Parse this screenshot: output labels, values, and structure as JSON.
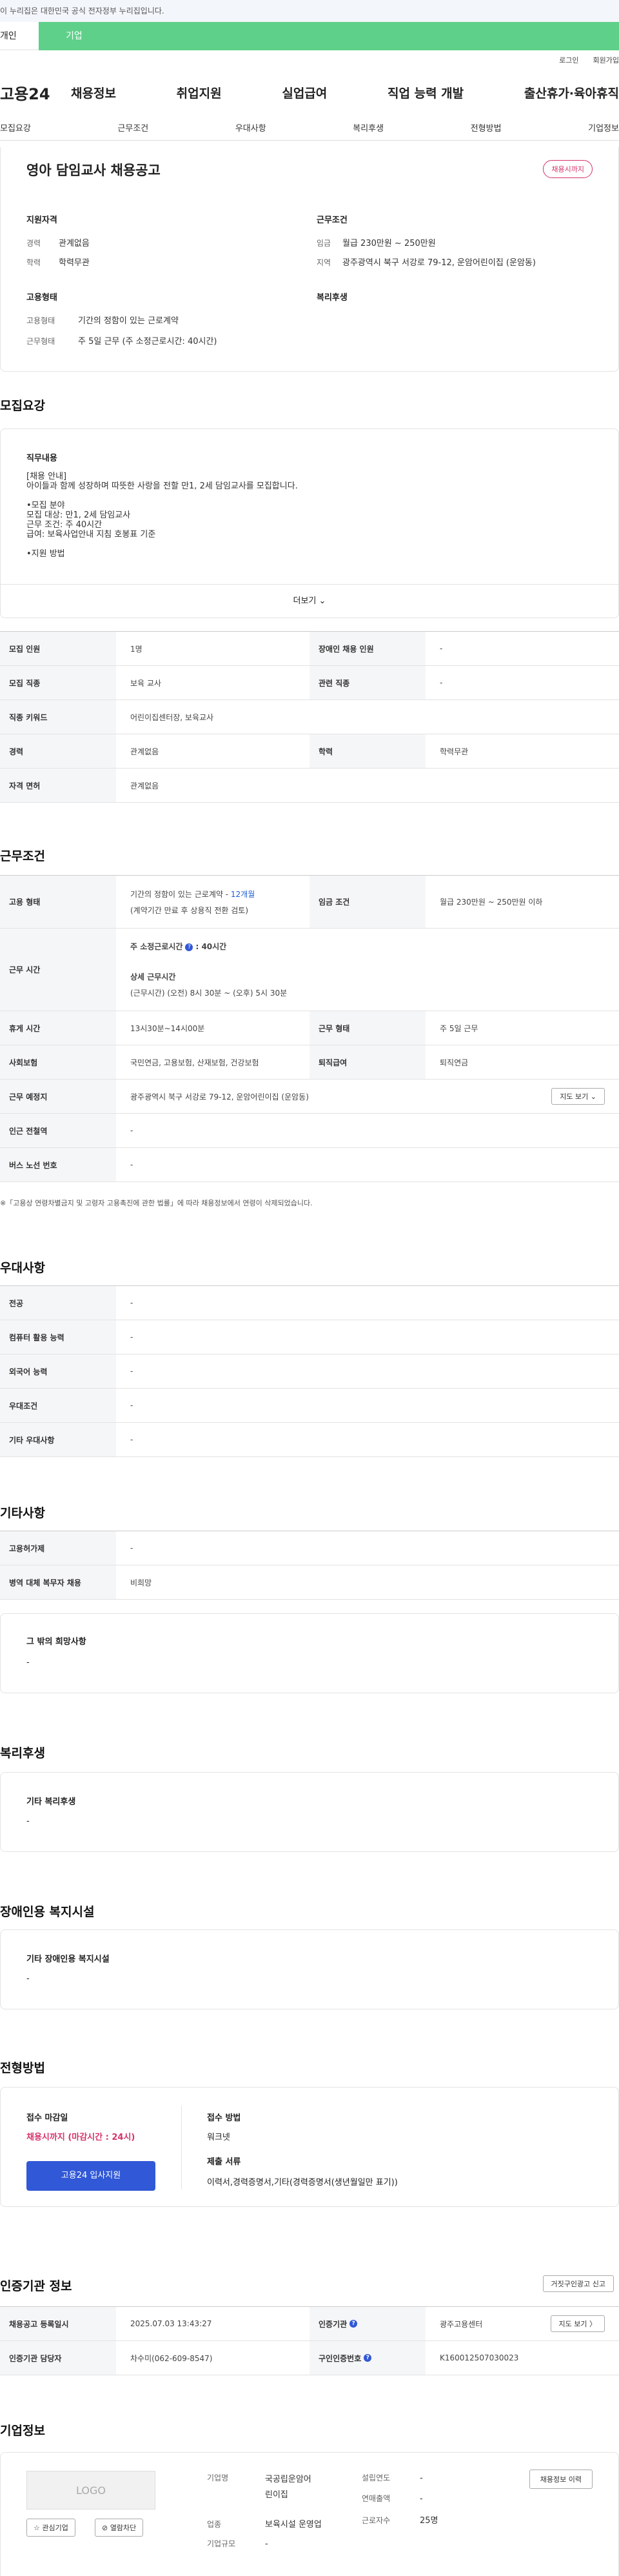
{
  "header": {
    "gov_notice": "이 누리집은 대한민국 공식 전자정부 누리집입니다.",
    "tab_person": "개인",
    "tab_company": "기업",
    "login": "로그인",
    "signup": "회원가입",
    "logo": "고용24"
  },
  "gnb": [
    "채용정보",
    "취업지원",
    "실업급여",
    "직업 능력 개발",
    "출산휴가·육아휴직"
  ],
  "subnav": [
    "모집요강",
    "근무조건",
    "우대사항",
    "복리후생",
    "전형방법",
    "기업정보"
  ],
  "summary": {
    "title": "영아 담임교사 채용공고",
    "badge": "채용시까지",
    "qual_heading": "지원자격",
    "career_label": "경력",
    "career": "관계없음",
    "edu_label": "학력",
    "edu": "학력무관",
    "cond_heading": "근무조건",
    "wage_label": "임금",
    "wage": "월급 230만원 ~ 250만원",
    "area_label": "지역",
    "area": "광주광역시 북구 서강로 79-12, 운암어린이집 (운암동)",
    "emp_heading": "고용형태",
    "emp_type_label": "고용형태",
    "emp_type": "기간의 정함이 있는 근로계약",
    "work_type_label": "근무형태",
    "work_type": "주 5일 근무 (주 소정근로시간: 40시간)",
    "welfare_heading": "복리후생"
  },
  "recruit": {
    "heading": "모집요강",
    "job_heading": "직무내용",
    "desc": [
      "[채용 안내]",
      "아이들과 함께 성장하며 따뜻한 사랑을 전할 만1, 2세 담임교사를 모집합니다.",
      "",
      "•모집 분야",
      "모집 대상: 만1, 2세 담임교사",
      "근무 조건: 주 40시간",
      "급여: 보육사업안내 지침 호봉표 기준",
      "",
      "•지원 방법"
    ],
    "more": "더보기 ⌄",
    "rows": [
      [
        "모집 인원",
        "1명",
        "장애인 채용 인원",
        "-"
      ],
      [
        "모집 직종",
        "보육 교사",
        "관련 직종",
        "-"
      ],
      [
        "직종 키워드",
        "어린이집센터장, 보육교사"
      ],
      [
        "경력",
        "관계없음",
        "학력",
        "학력무관"
      ],
      [
        "자격 면허",
        "관계없음"
      ]
    ]
  },
  "work": {
    "heading": "근무조건",
    "emp_label": "고용 형태",
    "emp_value": "기간의 정함이 있는 근로계약 - ",
    "emp_months": "12개월",
    "emp_note": "(계약기간 만료 후 상용직 전환 검토)",
    "wage_label": "임금 조건",
    "wage_value": "월급 230만원 ~ 250만원 이하",
    "hours_label": "근무 시간",
    "hours_title": "주 소정근로시간",
    "hours_value": ": 40시간",
    "detail_title": "상세 근무시간",
    "detail_value": "(근무시간) (오전) 8시 30분 ~ (오후) 5시 30분",
    "rest_label": "휴게 시간",
    "rest_value": "13시30분~14시00분",
    "form_label": "근무 형태",
    "form_value": "주 5일 근무",
    "ins_label": "사회보험",
    "ins_value": "국민연금, 고용보험, 산재보험, 건강보험",
    "ret_label": "퇴직급여",
    "ret_value": "퇴직연금",
    "place_label": "근무 예정지",
    "place_value": "광주광역시 북구 서강로 79-12, 운암어린이집 (운암동)",
    "map_btn": "지도 보기 ⌄",
    "subway_label": "인근 전철역",
    "subway_value": "-",
    "bus_label": "버스 노선 번호",
    "bus_value": "-",
    "notice": "※「고용상 연령차별금지 및 고령자 고용촉진에 관한 법률」에 따라 채용정보에서 연령이 삭제되었습니다."
  },
  "pref": {
    "heading": "우대사항",
    "rows": [
      [
        "전공",
        "-"
      ],
      [
        "컴퓨터 활용 능력",
        "-"
      ],
      [
        "외국어 능력",
        "-"
      ],
      [
        "우대조건",
        "-"
      ],
      [
        "기타 우대사항",
        "-"
      ]
    ]
  },
  "etc": {
    "heading": "기타사항",
    "rows": [
      [
        "고용허가제",
        "-"
      ],
      [
        "병역 대체 복무자 채용",
        "비희망"
      ]
    ],
    "hope_title": "그 밖의 희망사항",
    "hope_value": "-"
  },
  "welfare": {
    "heading": "복리후생",
    "title": "기타 복리후생",
    "value": "-"
  },
  "disabled": {
    "heading": "장애인용 복지시설",
    "title": "기타 장애인용 복지시설",
    "value": "-"
  },
  "screen": {
    "heading": "전형방법",
    "deadline_label": "접수 마감일",
    "deadline_value": "채용시까지 (마감시간 : 24시)",
    "apply_btn": "고용24 입사지원",
    "method_label": "접수 방법",
    "method_value": "워크넷",
    "docs_label": "제출 서류",
    "docs_value": "이력서,경력증명서,기타(경력증명서(생년월일만 표기))"
  },
  "agency": {
    "heading": "인증기관 정보",
    "report_btn": "거짓구인광고 신고",
    "reg_label": "채용공고 등록일시",
    "reg_value": "2025.07.03 13:43:27",
    "org_label": "인증기관",
    "org_value": "광주고용센터",
    "map_btn": "지도 보기 〉",
    "staff_label": "인증기관 담당자",
    "staff_value": "차수미(062-609-8547)",
    "cert_label": "구인인증번호",
    "cert_value": "K160012507030023"
  },
  "company": {
    "heading": "기업정보",
    "logo": "LOGO",
    "fav_btn": "☆ 관심기업",
    "block_btn": "⊘ 열람차단",
    "name_label": "기업명",
    "name_value": "국공립운암어린이집",
    "est_label": "설립연도",
    "est_value": "-",
    "sales_label": "연매출액",
    "sales_value": "-",
    "ind_label": "업종",
    "ind_value": "보육시설 운영업",
    "emp_label": "근로자수",
    "emp_value": "25명",
    "size_label": "기업규모",
    "size_value": "-",
    "history_btn": "채용정보 이력"
  },
  "colors": {
    "brand_green": "#5fd08a",
    "primary_blue": "#3158d6",
    "badge_red": "#d6336c"
  }
}
